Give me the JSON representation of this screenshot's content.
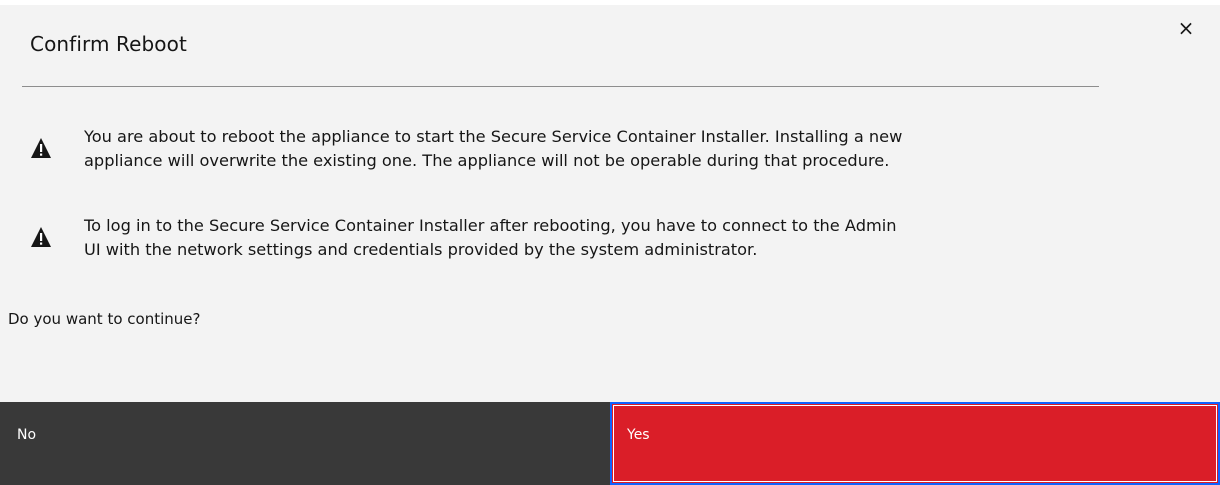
{
  "dialog": {
    "title": "Confirm Reboot",
    "close_label": "×",
    "warnings": [
      {
        "icon": "warning-icon",
        "text": "You are about to reboot the appliance to start the Secure Service Container Installer. Installing a new\nappliance will overwrite the existing one. The appliance will not be operable during that procedure."
      },
      {
        "icon": "warning-icon",
        "text": "To log in to the Secure Service Container Installer after rebooting, you have to connect to the Admin\nUI with the network settings and credentials provided by the system administrator."
      }
    ],
    "question": "Do you want to continue?",
    "buttons": {
      "no_label": "No",
      "yes_label": "Yes"
    }
  },
  "colors": {
    "background": "#f3f3f3",
    "secondary_button": "#393939",
    "danger_button": "#da1e28",
    "focus_border": "#0f62fe"
  }
}
